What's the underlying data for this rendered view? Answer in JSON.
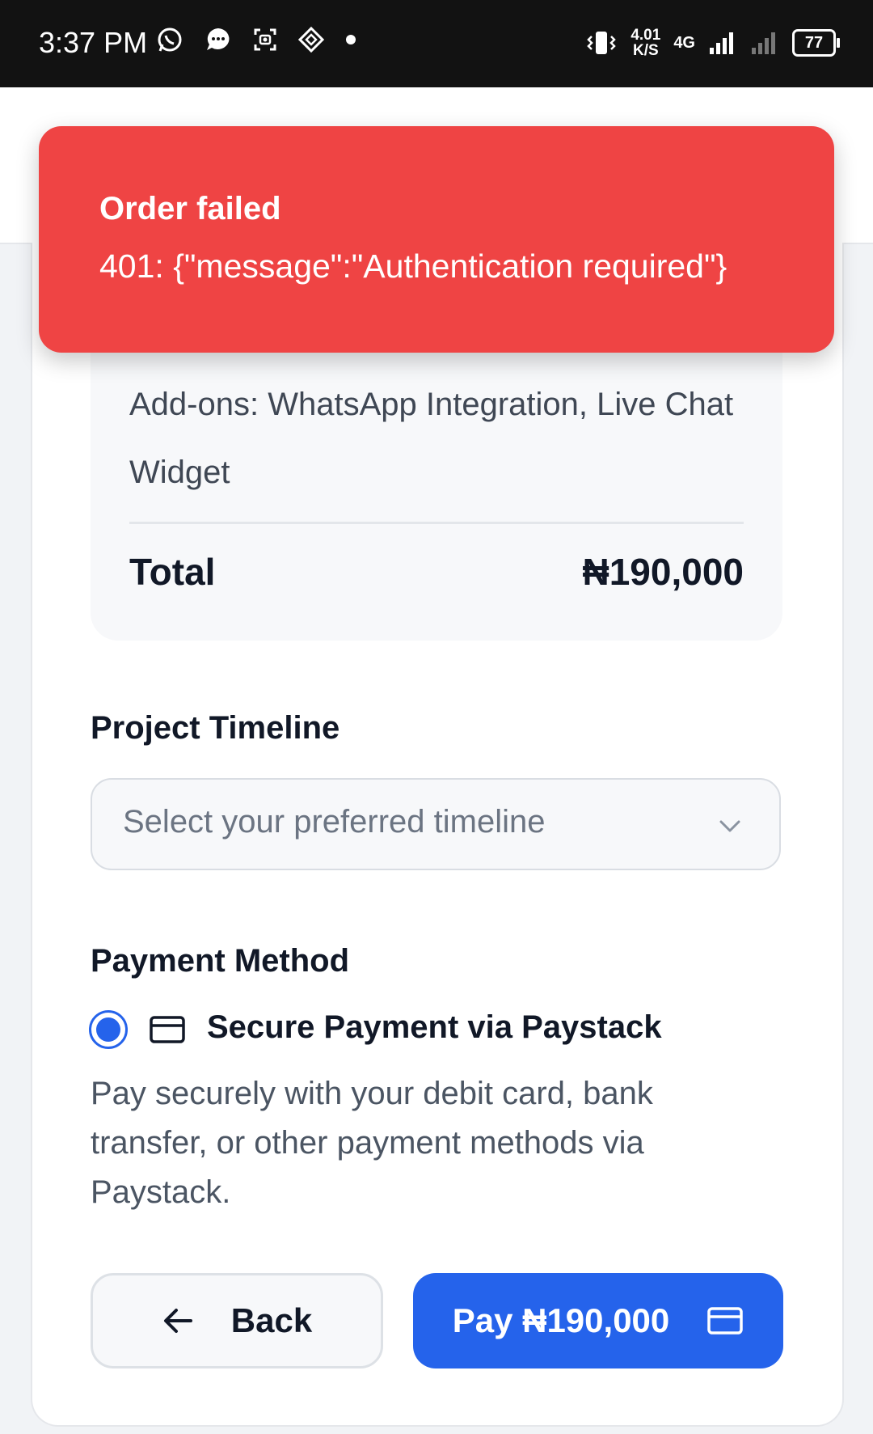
{
  "status_bar": {
    "time": "3:37 PM",
    "net_speed_value": "4.01",
    "net_speed_unit": "K/S",
    "net_type": "4G",
    "battery": "77",
    "left_icons": [
      "whatsapp-icon",
      "message-icon",
      "screenshot-icon",
      "app-icon",
      "dot-icon"
    ],
    "right_icons": [
      "vibrate-icon",
      "signal-icon",
      "signal-icon",
      "battery-icon"
    ]
  },
  "toast": {
    "title": "Order failed",
    "message": "401: {\"message\":\"Authentication required\"}",
    "color": "#ef4444"
  },
  "summary": {
    "addons": "Add-ons: WhatsApp Integration, Live Chat Widget",
    "total_label": "Total",
    "total_value": "₦190,000"
  },
  "timeline": {
    "label": "Project Timeline",
    "placeholder": "Select your preferred timeline",
    "icon": "chevron-down-icon"
  },
  "payment": {
    "label": "Payment Method",
    "option_label": "Secure Payment via Paystack",
    "option_selected": true,
    "option_icon": "credit-card-icon",
    "description": "Pay securely with your debit card, bank transfer, or other payment methods via Paystack."
  },
  "actions": {
    "back_label": "Back",
    "back_icon": "arrow-left-icon",
    "pay_label": "Pay ₦190,000",
    "pay_icon": "credit-card-icon",
    "accent_color": "#2563eb"
  }
}
